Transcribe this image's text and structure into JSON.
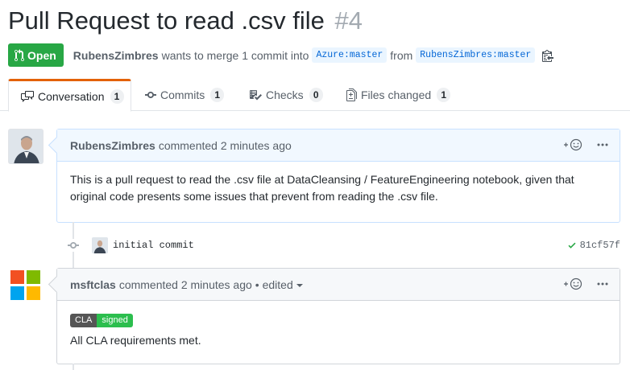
{
  "pr": {
    "title": "Pull Request to read .csv file",
    "number": "#4",
    "state": "Open",
    "author": "RubensZimbres",
    "merge_text": "wants to merge 1 commit into",
    "base_branch": "Azure:master",
    "from_text": "from",
    "head_branch": "RubensZimbres:master"
  },
  "tabs": [
    {
      "label": "Conversation",
      "count": "1",
      "icon": "comment-discussion-icon"
    },
    {
      "label": "Commits",
      "count": "1",
      "icon": "git-commit-icon"
    },
    {
      "label": "Checks",
      "count": "0",
      "icon": "checklist-icon"
    },
    {
      "label": "Files changed",
      "count": "1",
      "icon": "file-diff-icon"
    }
  ],
  "comments": [
    {
      "author": "RubensZimbres",
      "action": "commented 2 minutes ago",
      "body": "This is a pull request to read the .csv file at DataCleansing / FeatureEngineering notebook, given that original code presents some issues that prevent from reading the .csv file."
    },
    {
      "author": "msftclas",
      "action": "commented 2 minutes ago",
      "edited": "• edited",
      "badge_left": "CLA",
      "badge_right": "signed",
      "body": "All CLA requirements met."
    }
  ],
  "commit": {
    "message": "initial commit",
    "sha": "81cf57f",
    "status": "success"
  },
  "colors": {
    "open_green": "#28a745",
    "active_tab_accent": "#e36209",
    "link_blue": "#0366d6",
    "comment_header_bg": "#f1f8ff"
  }
}
